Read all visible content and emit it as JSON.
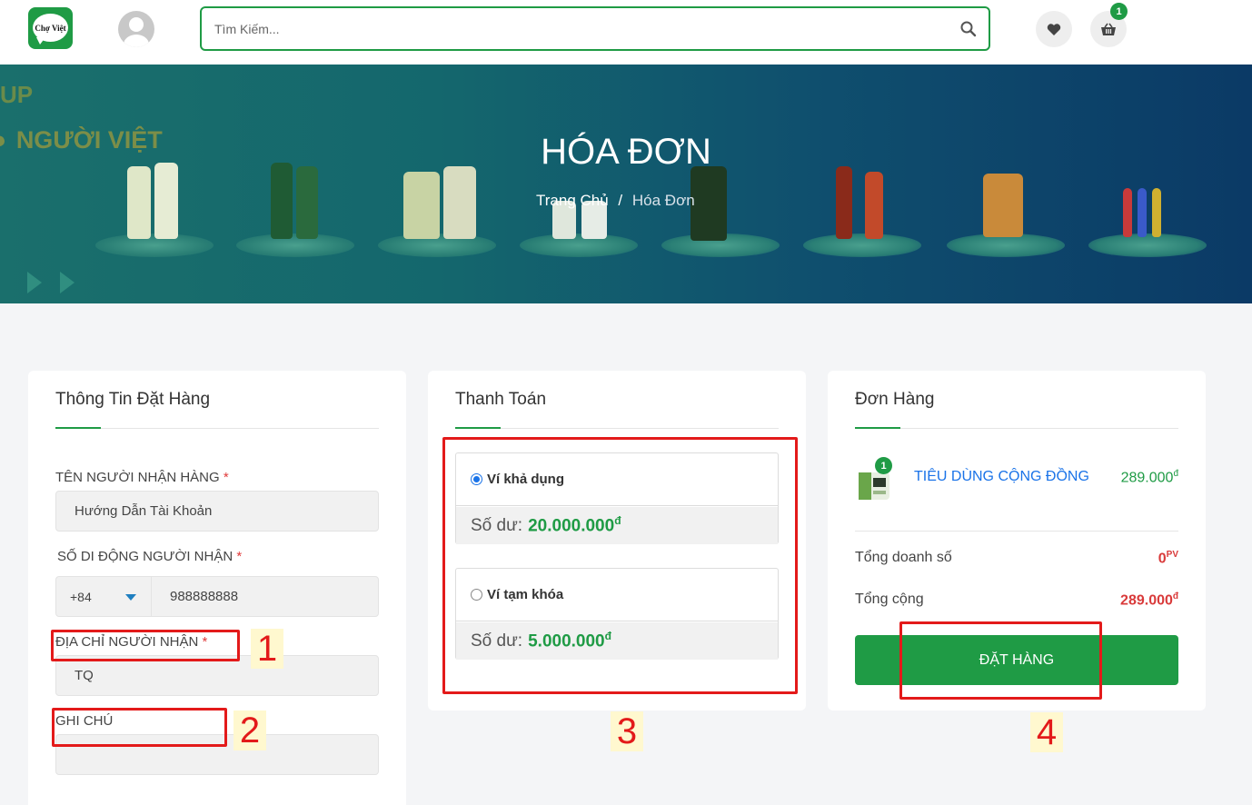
{
  "header": {
    "logo_text": "Chợ Việt",
    "search_placeholder": "Tìm Kiếm...",
    "cart_count": "1"
  },
  "banner": {
    "bg_text_1": "UP",
    "bg_text_2": "NGƯỜI VIỆT",
    "title": "HÓA ĐƠN",
    "breadcrumb_home": "Trang Chủ",
    "breadcrumb_sep": "/",
    "breadcrumb_current": "Hóa Đơn"
  },
  "order_info": {
    "title": "Thông Tin Đặt Hàng",
    "name_label": "TÊN NGƯỜI NHẬN HÀNG",
    "name_value": "Hướng Dẫn Tài Khoản",
    "phone_label": "SỐ DI ĐỘNG NGƯỜI NHẬN",
    "phone_code": "+84",
    "phone_value": "988888888",
    "address_label": "ĐỊA CHỈ NGƯỜI NHẬN",
    "address_value": "TQ",
    "note_label": "GHI CHÚ",
    "note_value": "",
    "required_mark": "*"
  },
  "payment": {
    "title": "Thanh Toán",
    "wallets": [
      {
        "label": "Ví khả dụng",
        "balance_label": "Số dư:",
        "balance": "20.000.000",
        "currency": "đ",
        "selected": true
      },
      {
        "label": "Ví tạm khóa",
        "balance_label": "Số dư:",
        "balance": "5.000.000",
        "currency": "đ",
        "selected": false
      }
    ]
  },
  "order": {
    "title": "Đơn Hàng",
    "item_name": "TIÊU DÙNG CỘNG ĐỒNG",
    "item_qty": "1",
    "item_price": "289.000",
    "currency": "đ",
    "total_sales_label": "Tổng doanh số",
    "total_sales_value": "0",
    "total_sales_unit": "PV",
    "total_label": "Tổng cộng",
    "total_value": "289.000",
    "place_order_label": "ĐẶT HÀNG"
  },
  "annotations": [
    "1",
    "2",
    "3",
    "4"
  ],
  "colors": {
    "brand_green": "#1f9b45",
    "link_blue": "#1a73e8",
    "annotation_red": "#e31a1a",
    "price_red": "#d93a3a"
  }
}
